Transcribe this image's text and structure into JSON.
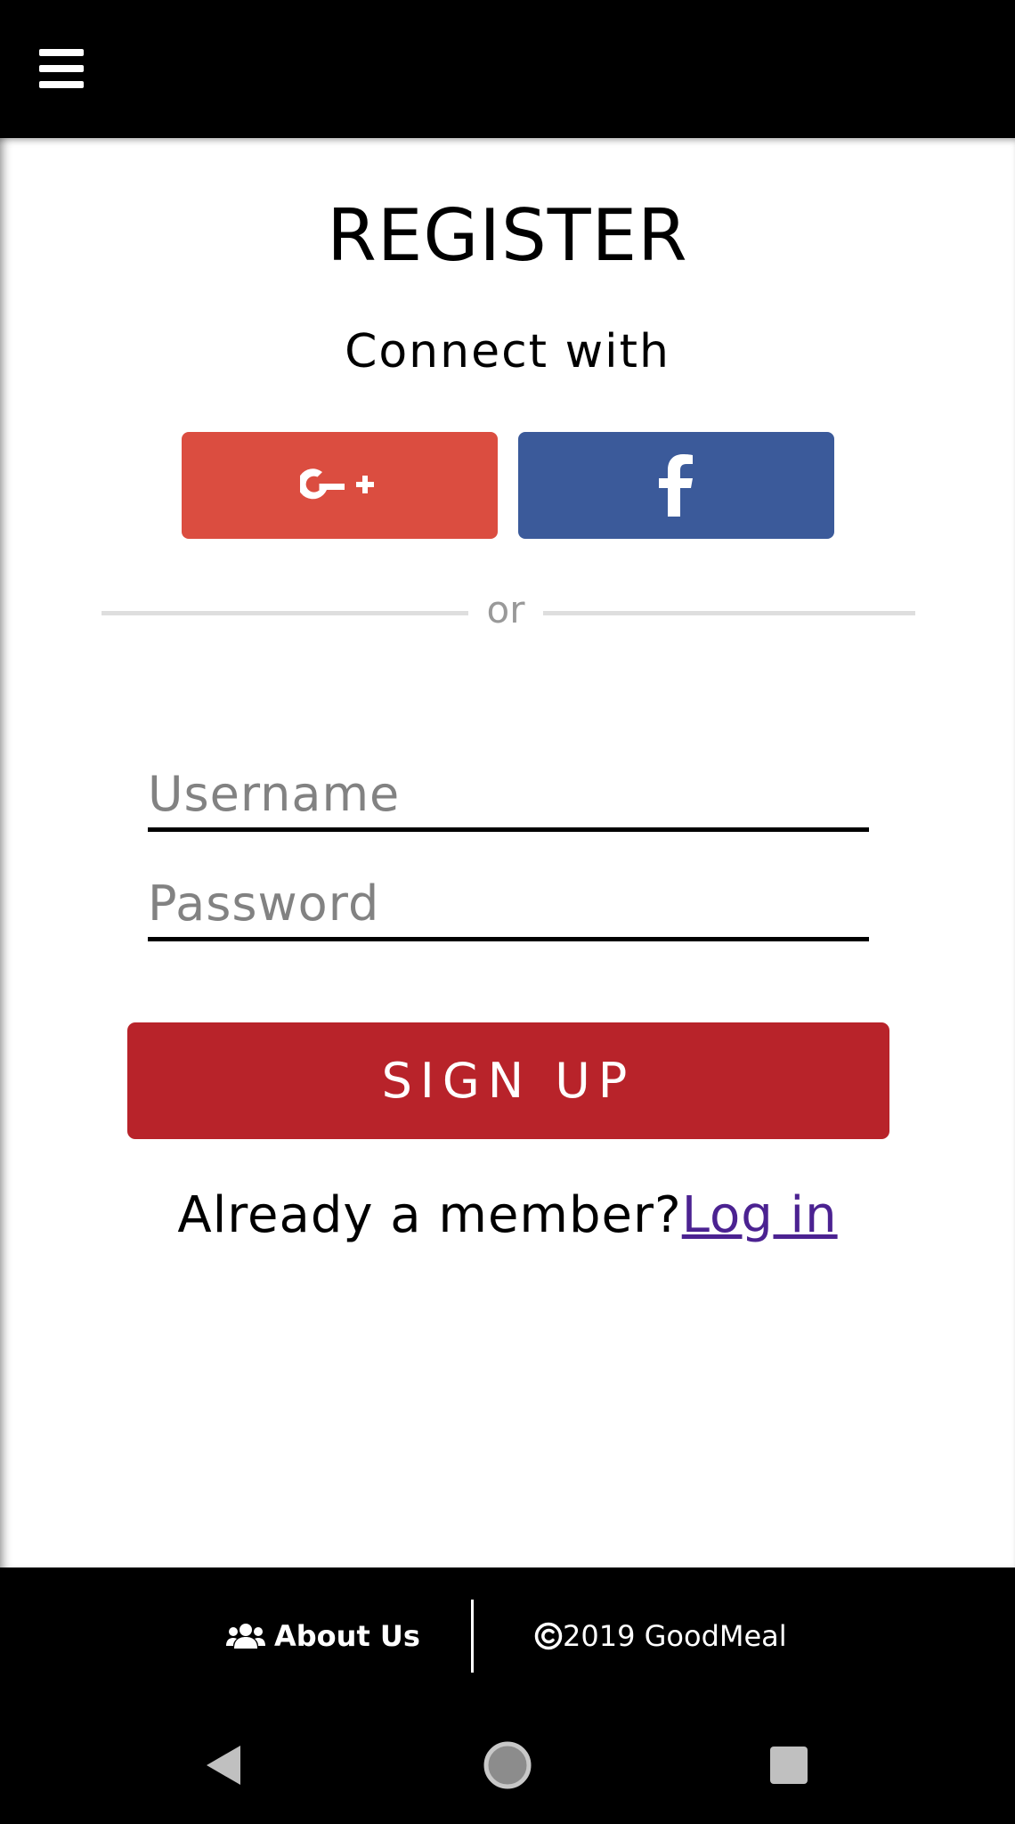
{
  "header": {
    "menu_icon": "hamburger-menu-icon"
  },
  "register": {
    "title": "REGISTER",
    "subtitle": "Connect with",
    "google": {
      "icon": "google-plus-icon",
      "color": "#db4d40"
    },
    "facebook": {
      "icon": "facebook-icon",
      "color": "#3b5a9a"
    },
    "divider_text": "or",
    "username": {
      "placeholder": "Username",
      "value": ""
    },
    "password": {
      "placeholder": "Password",
      "value": ""
    },
    "signup_label": "SIGN UP",
    "signup_color": "#b8232a",
    "member_text": "Already a member?",
    "login_label": "Log in",
    "login_color": "#4b2291"
  },
  "footer": {
    "about_icon": "users-icon",
    "about_label": "About Us",
    "copyright_icon": "copyright-icon",
    "copyright_text": "2019 GoodMeal"
  },
  "system_nav": {
    "back_icon": "back-triangle-icon",
    "home_icon": "home-circle-icon",
    "recent_icon": "recent-apps-square-icon"
  }
}
